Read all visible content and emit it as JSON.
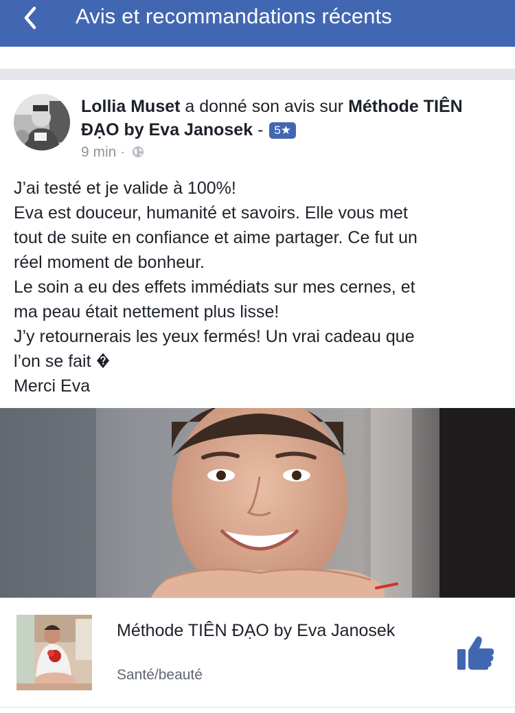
{
  "header": {
    "title": "Avis et recommandations récents",
    "back_icon": "chevron-left-icon"
  },
  "post": {
    "author": "Lollia Muset",
    "action": " a donné son avis sur ",
    "page_name": "Méthode TIÊN ĐẠO by Eva Janosek",
    "dash": " - ",
    "rating": "5★",
    "rating_value": 5,
    "time": "9 min",
    "meta_separator": " · ",
    "privacy_icon": "globe-icon",
    "review_lines": [
      "J’ai testé et je valide à 100%!",
      "Eva est douceur, humanité et savoirs. Elle vous met",
      "tout de suite en confiance et aime partager. Ce fut un",
      "réel moment de bonheur.",
      "Le soin a eu des effets immédiats sur mes cernes, et",
      "ma peau était nettement plus lisse!",
      "J’y retournerais les yeux fermés! Un vrai cadeau que",
      "l’on se fait",
      "Merci Eva"
    ]
  },
  "page_card": {
    "name": "Méthode TIÊN ĐẠO by Eva Janosek",
    "category": "Santé/beauté",
    "like_icon": "thumbs-up-icon"
  },
  "colors": {
    "brand_blue": "#4267b2",
    "separator_gray": "#e4e6eb",
    "meta_gray": "#90949c",
    "text": "#1d2129"
  }
}
